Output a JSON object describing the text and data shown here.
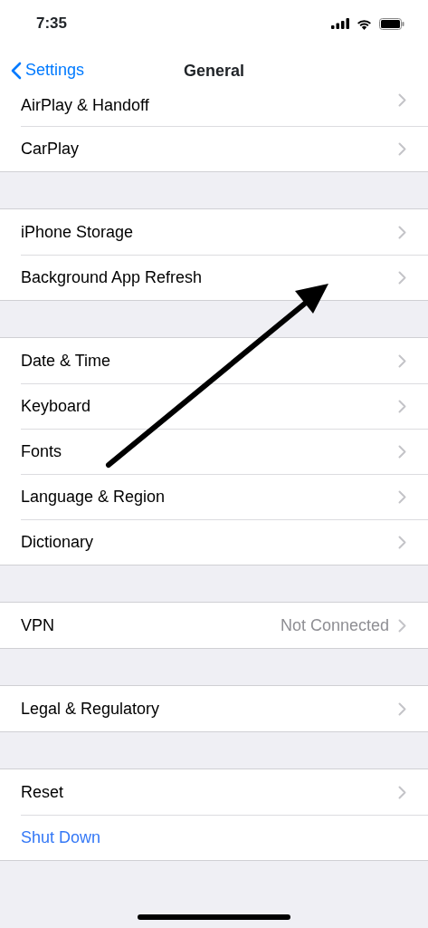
{
  "status_bar": {
    "time": "7:35"
  },
  "nav": {
    "back": "Settings",
    "title": "General"
  },
  "groups": [
    {
      "rows": [
        {
          "label": "AirPlay & Handoff",
          "kind": "nav",
          "cut": true
        },
        {
          "label": "CarPlay",
          "kind": "nav"
        }
      ]
    },
    {
      "rows": [
        {
          "label": "iPhone Storage",
          "kind": "nav"
        },
        {
          "label": "Background App Refresh",
          "kind": "nav"
        }
      ]
    },
    {
      "rows": [
        {
          "label": "Date & Time",
          "kind": "nav"
        },
        {
          "label": "Keyboard",
          "kind": "nav"
        },
        {
          "label": "Fonts",
          "kind": "nav"
        },
        {
          "label": "Language & Region",
          "kind": "nav"
        },
        {
          "label": "Dictionary",
          "kind": "nav"
        }
      ]
    },
    {
      "rows": [
        {
          "label": "VPN",
          "kind": "nav",
          "value": "Not Connected"
        }
      ]
    },
    {
      "rows": [
        {
          "label": "Legal & Regulatory",
          "kind": "nav"
        }
      ]
    },
    {
      "rows": [
        {
          "label": "Reset",
          "kind": "nav"
        },
        {
          "label": "Shut Down",
          "kind": "action"
        }
      ]
    }
  ],
  "annotations": [
    {
      "kind": "arrow"
    }
  ]
}
